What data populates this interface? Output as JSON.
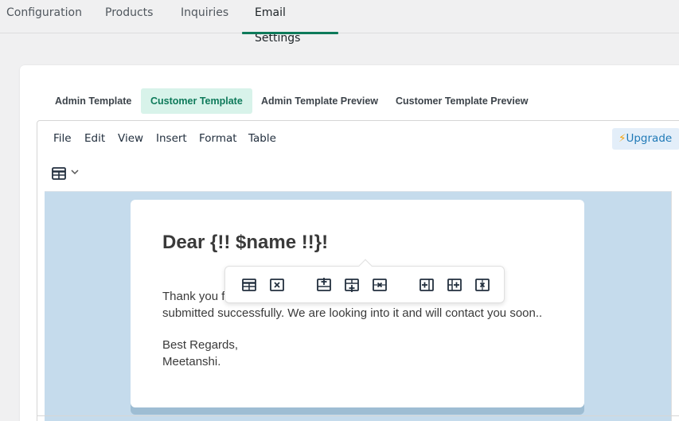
{
  "top_tabs": [
    {
      "label": "Configuration"
    },
    {
      "label": "Products"
    },
    {
      "label": "Inquiries"
    },
    {
      "label": "Email Settings",
      "active": true
    }
  ],
  "sub_tabs": [
    {
      "label": "Admin Template"
    },
    {
      "label": "Customer Template",
      "active": true
    },
    {
      "label": "Admin Template Preview"
    },
    {
      "label": "Customer Template Preview"
    }
  ],
  "menubar": {
    "items": [
      "File",
      "Edit",
      "View",
      "Insert",
      "Format",
      "Table"
    ],
    "upgrade_icon": "⚡",
    "upgrade_label": "Upgrade"
  },
  "toolbar": {
    "table_icon": "table-icon",
    "dropdown_icon": "chevron-down-icon"
  },
  "email": {
    "greeting": "Dear {!! $name !!}!",
    "paragraph1_visible": "Thank you f",
    "paragraph1_line2": "submitted successfully. We are looking into it and will contact you soon..",
    "regards": "Best Regards,",
    "signature": "Meetanshi."
  },
  "table_toolbar": {
    "buttons": [
      "table-properties-icon",
      "delete-table-icon",
      "insert-row-before-icon",
      "insert-row-after-icon",
      "delete-row-icon",
      "insert-column-before-icon",
      "insert-column-after-icon",
      "delete-column-icon"
    ]
  },
  "colors": {
    "accent": "#0e7a5a",
    "active_tab_bg": "#d8f3ea",
    "canvas_bg": "#c5dbec",
    "upgrade_bg": "#e3eef9",
    "upgrade_text": "#207ab7"
  }
}
